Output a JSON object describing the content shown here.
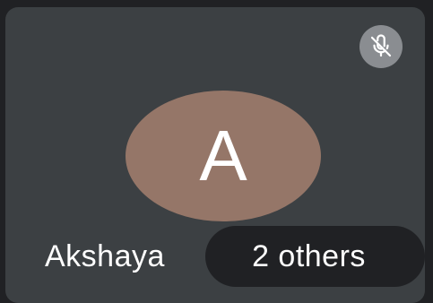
{
  "tile": {
    "participant_name": "Akshaya",
    "avatar_initial": "A",
    "others_label": "2 others",
    "mute_icon": "mic-off-icon"
  },
  "colors": {
    "background": "#202124",
    "tile": "#3c4043",
    "avatar": "#957668",
    "mute_badge": "#8a8d91",
    "pill": "#202124",
    "text": "#ffffff"
  }
}
